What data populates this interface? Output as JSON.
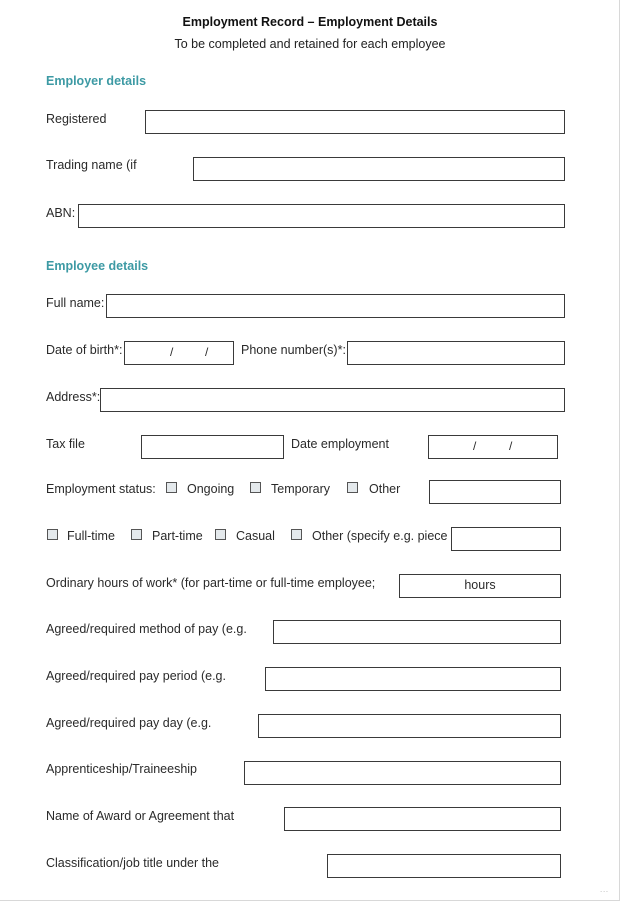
{
  "header": {
    "title": "Employment Record – Employment Details",
    "subtitle": "To be completed and retained for each employee"
  },
  "employer_section": {
    "heading": "Employer details",
    "fields": {
      "registered": {
        "label": "Registered",
        "value": ""
      },
      "trading_name": {
        "label": "Trading name (if",
        "value": ""
      },
      "abn": {
        "label": "ABN:",
        "value": ""
      }
    }
  },
  "employee_section": {
    "heading": "Employee details",
    "fields": {
      "full_name": {
        "label": "Full name:",
        "value": ""
      },
      "date_of_birth": {
        "label": "Date of birth*:",
        "separator": "/"
      },
      "phone": {
        "label": "Phone number(s)*:",
        "value": ""
      },
      "address": {
        "label": "Address*:",
        "value": ""
      },
      "tax_file": {
        "label": "Tax file",
        "value": ""
      },
      "date_employment": {
        "label": "Date employment",
        "separator": "/"
      },
      "employment_status": {
        "label": "Employment status:",
        "options": [
          {
            "label": "Ongoing",
            "checked": false
          },
          {
            "label": "Temporary",
            "checked": false
          },
          {
            "label": "Other",
            "checked": false
          }
        ],
        "other_value": ""
      },
      "work_type": {
        "options": [
          {
            "label": "Full-time",
            "checked": false
          },
          {
            "label": "Part-time",
            "checked": false
          },
          {
            "label": "Casual",
            "checked": false
          },
          {
            "label": "Other (specify e.g. piece",
            "checked": false
          }
        ],
        "other_value": ""
      },
      "ordinary_hours": {
        "label": "Ordinary hours of work* (for part-time or full-time employee;",
        "suffix": "hours"
      },
      "pay_method": {
        "label": "Agreed/required method of pay (e.g.",
        "value": ""
      },
      "pay_period": {
        "label": "Agreed/required pay period (e.g.",
        "value": ""
      },
      "pay_day": {
        "label": "Agreed/required pay day (e.g.",
        "value": ""
      },
      "apprenticeship": {
        "label": "Apprenticeship/Traineeship",
        "value": ""
      },
      "award_name": {
        "label": "Name of Award or Agreement that",
        "value": ""
      },
      "classification": {
        "label": "Classification/job title under the",
        "value": ""
      }
    }
  },
  "footer": {
    "page_mark": "..."
  }
}
